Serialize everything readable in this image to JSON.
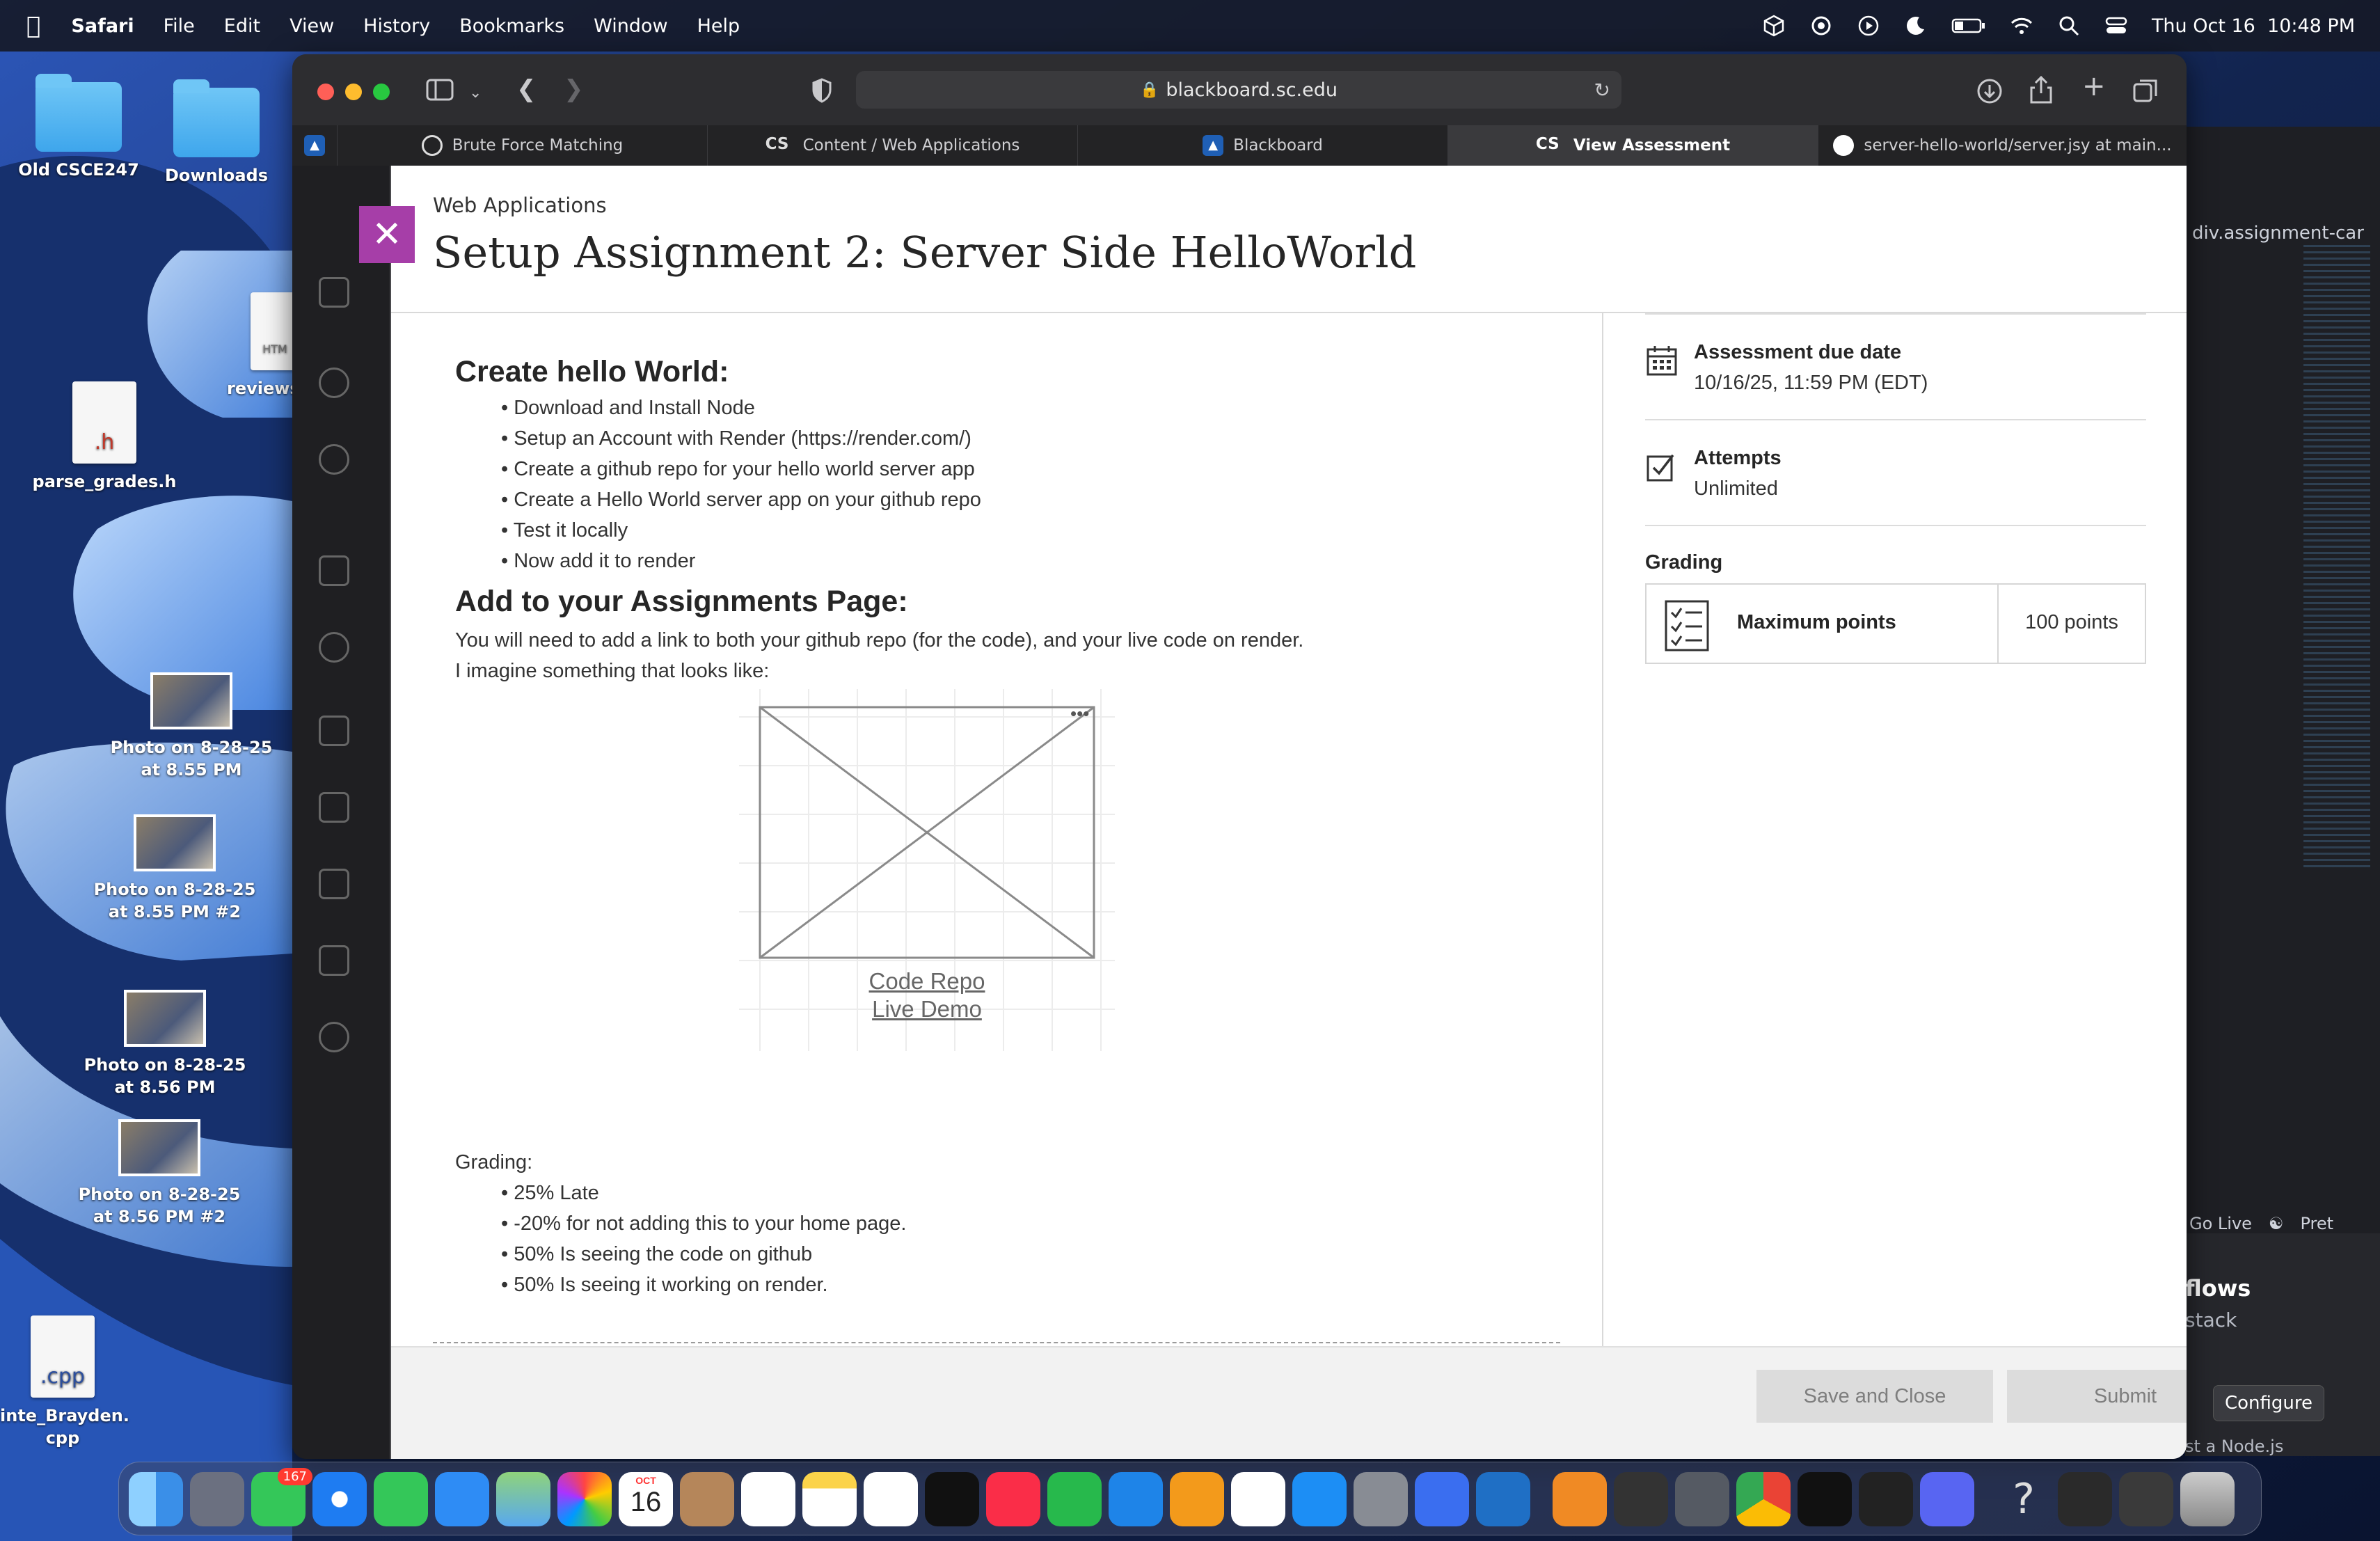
{
  "menubar": {
    "items": [
      "Safari",
      "File",
      "Edit",
      "View",
      "History",
      "Bookmarks",
      "Window",
      "Help"
    ],
    "clock": "Thu Oct 16  10:48 PM"
  },
  "desktop": {
    "icons": [
      {
        "label": "Old CSCE247"
      },
      {
        "label": "Downloads"
      },
      {
        "label": "reviews",
        "badge": "HTM"
      },
      {
        "label": "parse_grades.h",
        "badge": ".h"
      },
      {
        "label": "Photo on 8-28-25 at 8.55 PM"
      },
      {
        "label": "Photo on 8-28-25 at 8.55 PM #2"
      },
      {
        "label": "Photo on 8-28-25 at 8.56 PM"
      },
      {
        "label": "Photo on 8-28-25 at 8.56 PM #2"
      },
      {
        "label": "inte_Brayden.\ncpp",
        "badge": ".cpp"
      }
    ]
  },
  "safari": {
    "url": "blackboard.sc.edu",
    "tabs": [
      {
        "label": "Brute Force Matching"
      },
      {
        "label": "Content / Web Applications"
      },
      {
        "label": "Blackboard"
      },
      {
        "label": "View Assessment"
      },
      {
        "label": "server-hello-world/server.jsy at main..."
      }
    ]
  },
  "assessment": {
    "breadcrumb": "Web Applications",
    "title": "Setup Assignment 2: Server Side HelloWorld",
    "heading1": "Create hello World:",
    "steps": [
      "Download and Install Node",
      "Setup an Account with Render (https://render.com/)",
      "Create a github repo for your hello world server app",
      "Create a Hello World server app on your github repo",
      "Test it locally",
      "Now add it to render"
    ],
    "heading2": "Add to your Assignments Page:",
    "para1": "You will need to add a link to both your github repo (for the code), and your live code on render.",
    "para2": "I imagine something that looks like:",
    "wireframe_links": [
      "Code Repo",
      "Live Demo"
    ],
    "wireframe_menu": "•••",
    "grading_label": "Grading:",
    "grading_items": [
      "25% Late",
      "-20% for not adding this to your home page.",
      "50% Is seeing the code on github",
      "50% Is seeing it working on render."
    ]
  },
  "sidebar": {
    "due_label": "Assessment due date",
    "due_value": "10/16/25, 11:59 PM (EDT)",
    "attempts_label": "Attempts",
    "attempts_value": "Unlimited",
    "grading_label": "Grading",
    "max_points_label": "Maximum points",
    "max_points_value": "100 points"
  },
  "footer": {
    "save_label": "Save and Close",
    "submit_label": "Submit"
  },
  "editor": {
    "crumb": "div.assignment-car",
    "status_go_live": "Go Live",
    "status_pret": "Pret",
    "panel_title": "flows",
    "panel_sub": "stack",
    "configure": "Configure",
    "panel_hint": "st a Node.js"
  },
  "dock": {
    "messages_badge": "167",
    "calendar_month": "OCT",
    "calendar_day": "16"
  },
  "colors": {
    "accent_purple": "#a63ea8",
    "panel_bg": "#ffffff",
    "button_disabled": "#dcdcdc"
  }
}
